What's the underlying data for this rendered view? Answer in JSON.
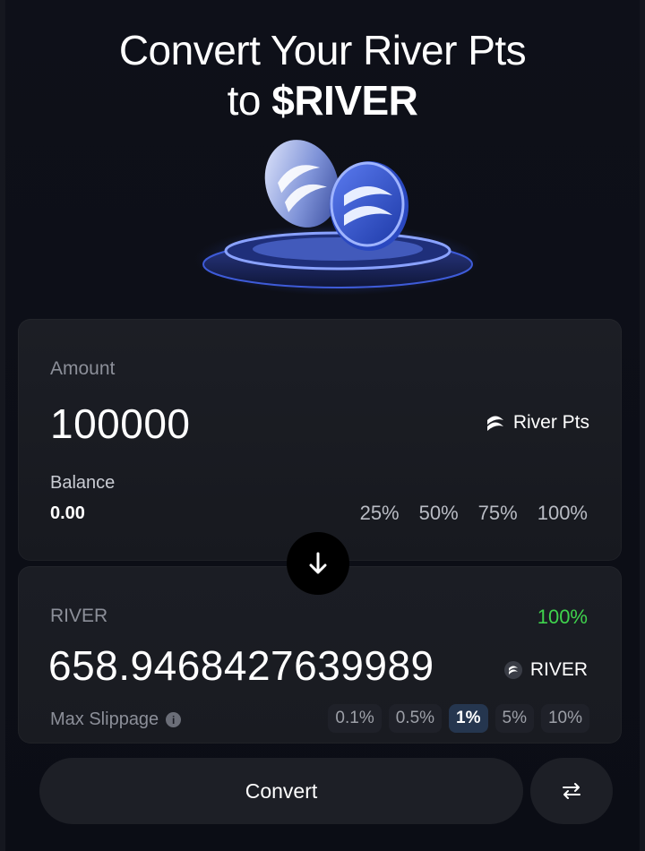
{
  "hero": {
    "title_line1": "Convert Your River Pts",
    "title_prefix": "to ",
    "title_token": "$RIVER"
  },
  "input_card": {
    "label": "Amount",
    "value": "100000",
    "token": "River Pts",
    "token_icon": "river-logo-icon",
    "balance_label": "Balance",
    "balance_value": "0.00",
    "percent_options": [
      "25%",
      "50%",
      "75%",
      "100%"
    ]
  },
  "swap": {
    "icon": "arrow-down-icon"
  },
  "output_card": {
    "label": "RIVER",
    "percent": "100%",
    "value": "658.9468427639989",
    "token": "RIVER",
    "token_icon": "river-coin-icon",
    "slippage_label": "Max Slippage",
    "slippage_options": [
      "0.1%",
      "0.5%",
      "1%",
      "5%",
      "10%"
    ],
    "slippage_selected": "1%"
  },
  "actions": {
    "convert_label": "Convert",
    "flip_icon": "swap-arrows-icon"
  },
  "colors": {
    "background": "#0d0f17",
    "card": "#1a1c23",
    "accent_green": "#3fd34d",
    "slippage_active": "#25364f"
  }
}
